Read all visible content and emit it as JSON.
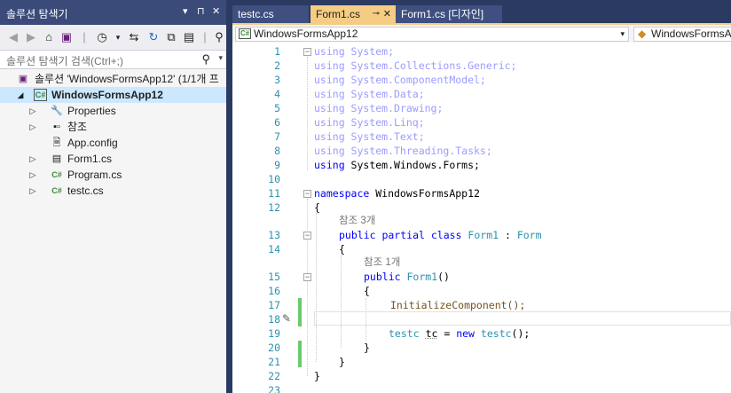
{
  "solution_explorer": {
    "title": "솔루션 탐색기",
    "title_controls": [
      "▾",
      "⊓",
      "✕"
    ],
    "search_placeholder": "솔루션 탐색기 검색(Ctrl+;)",
    "tree": {
      "solution": "솔루션 'WindowsFormsApp12' (1/1개 프",
      "project": "WindowsFormsApp12",
      "items": [
        {
          "label": "Properties",
          "icon": "wrench-icon"
        },
        {
          "label": "참조",
          "icon": "references-icon"
        },
        {
          "label": "App.config",
          "icon": "config-file-icon"
        },
        {
          "label": "Form1.cs",
          "icon": "form-icon"
        },
        {
          "label": "Program.cs",
          "icon": "csharp-file-icon"
        },
        {
          "label": "testc.cs",
          "icon": "csharp-file-icon"
        }
      ]
    }
  },
  "editor": {
    "tabs": [
      {
        "label": "testc.cs"
      },
      {
        "label": "Form1.cs",
        "active": true
      },
      {
        "label": "Form1.cs [디자인]"
      }
    ],
    "nav": {
      "project_dropdown": "WindowsFormsApp12",
      "type_dropdown": "WindowsFormsA"
    },
    "line_numbers": [
      "1",
      "2",
      "3",
      "4",
      "5",
      "6",
      "7",
      "8",
      "9",
      "10",
      "11",
      "12",
      "13",
      "14",
      "15",
      "16",
      "17",
      "18",
      "19",
      "20",
      "21",
      "22",
      "23"
    ],
    "code": {
      "l1": "using System;",
      "l2": "using System.Collections.Generic;",
      "l3": "using System.ComponentModel;",
      "l4": "using System.Data;",
      "l5": "using System.Drawing;",
      "l6": "using System.Linq;",
      "l7": "using System.Text;",
      "l8": "using System.Threading.Tasks;",
      "l9_kw": "using",
      "l9_rest": " System.Windows.Forms;",
      "l11_kw": "namespace",
      "l11_rest": " WindowsFormsApp12",
      "open_brace": "{",
      "close_brace": "}",
      "ref_class": "참조 3개",
      "l13_kw": "public partial class",
      "l13_type": "Form1",
      "l13_colon": " : ",
      "l13_base": "Form",
      "ref_ctor": "참조 1개",
      "l15_kw": "public",
      "l15_type": "Form1",
      "l15_paren": "()",
      "l17": "InitializeComponent();",
      "l19_type": "testc",
      "l19_var": "tc",
      "l19_eq": " = ",
      "l19_new": "new",
      "l19_ctor": "testc",
      "l19_tail": "();"
    }
  }
}
